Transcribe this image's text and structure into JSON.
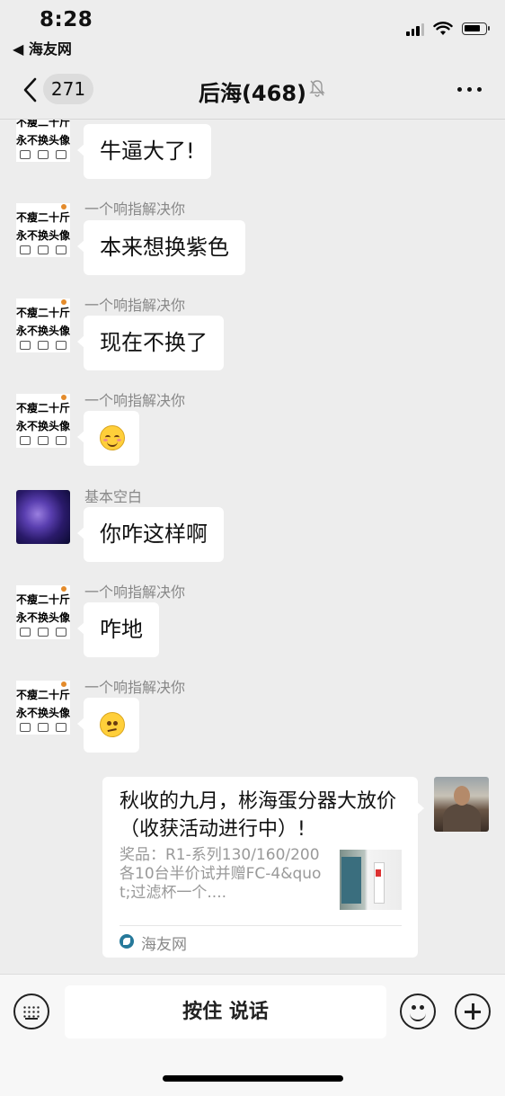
{
  "status_bar": {
    "time": "8:28",
    "back_app": "◀ 海友网"
  },
  "nav": {
    "unread_count": "271",
    "title": "后海(468)"
  },
  "messages": [
    {
      "sender": "",
      "text": "牛逼大了!",
      "avatar": "meme"
    },
    {
      "sender": "一个响指解决你",
      "text": "本来想换紫色",
      "avatar": "meme"
    },
    {
      "sender": "一个响指解决你",
      "text": "现在不换了",
      "avatar": "meme"
    },
    {
      "sender": "一个响指解决你",
      "emoji": "smiling-face-emoji",
      "avatar": "meme"
    },
    {
      "sender": "基本空白",
      "text": "你咋这样啊",
      "avatar": "coral"
    },
    {
      "sender": "一个响指解决你",
      "text": "咋地",
      "avatar": "meme"
    },
    {
      "sender": "一个响指解决你",
      "emoji": "confused-face-emoji",
      "avatar": "meme"
    }
  ],
  "meme_avatar": {
    "line1": "不瘦二十斤",
    "line2": "永不换头像"
  },
  "link_card": {
    "title": "秋收的九月，彬海蛋分器大放价（收获活动进行中）!",
    "description": "奖品：R1-系列130/160/200各10台半价试并赠FC-4&quot;过滤杯一个....",
    "source": "海友网"
  },
  "input_bar": {
    "voice_label": "按住 说话"
  },
  "colors": {
    "background": "#ededed",
    "bubble": "#ffffff",
    "secondary_text": "#888888"
  }
}
